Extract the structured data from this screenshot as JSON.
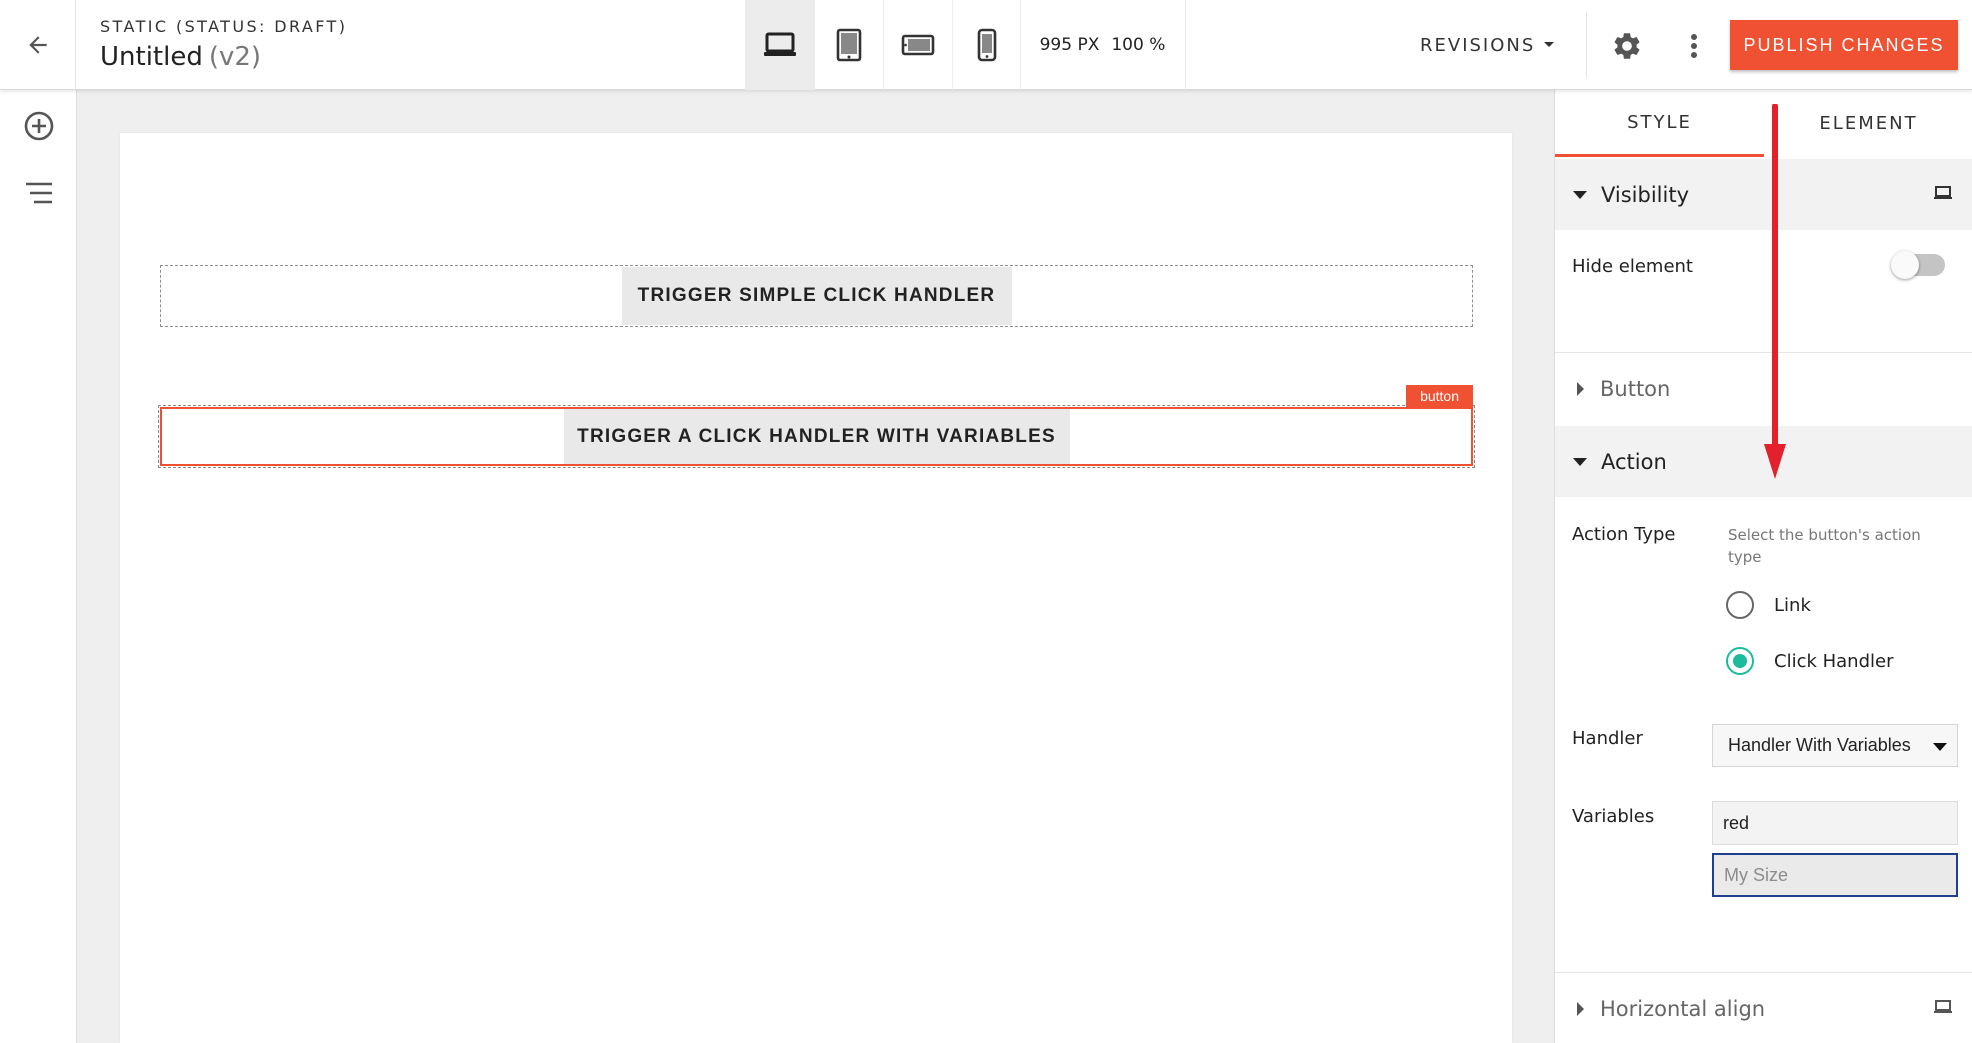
{
  "header": {
    "status": "STATIC (STATUS: DRAFT)",
    "title": "Untitled",
    "version": "(v2)",
    "viewport_width": "995 PX",
    "zoom": "100 %",
    "revisions_label": "REVISIONS",
    "publish_label": "PUBLISH CHANGES",
    "devices": [
      "laptop-icon",
      "tablet-icon",
      "tablet-landscape-icon",
      "phone-icon"
    ],
    "active_device": "laptop-icon"
  },
  "left_rail": {
    "icons": [
      "add-circle-icon",
      "layers-list-icon"
    ]
  },
  "canvas": {
    "button_1": "TRIGGER SIMPLE CLICK HANDLER",
    "button_2": "TRIGGER A CLICK HANDLER WITH VARIABLES",
    "selected_tag": "button"
  },
  "panel": {
    "tabs": [
      {
        "label": "STYLE",
        "active": true
      },
      {
        "label": "ELEMENT",
        "active": false
      }
    ],
    "visibility": {
      "title": "Visibility",
      "hide_element_label": "Hide element",
      "hide_element_on": false
    },
    "button_section": {
      "title": "Button"
    },
    "action": {
      "title": "Action",
      "action_type_label": "Action Type",
      "hint": "Select the button's action type",
      "options": [
        {
          "label": "Link",
          "checked": false
        },
        {
          "label": "Click Handler",
          "checked": true
        }
      ],
      "handler_label": "Handler",
      "handler_value": "Handler With Variables",
      "variables_label": "Variables",
      "variable_1_value": "red",
      "variable_2_placeholder": "My Size"
    },
    "horizontal_align": {
      "title": "Horizontal align"
    }
  },
  "colors": {
    "accent": "#f15133",
    "radio_checked": "#1bbc9b",
    "focus_border": "#1e3e8e",
    "annotation_arrow": "#e3202b"
  }
}
